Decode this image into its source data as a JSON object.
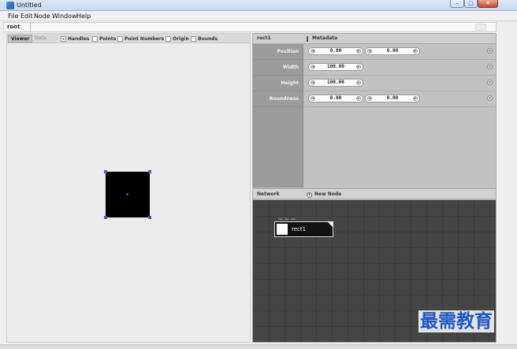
{
  "window": {
    "title": "Untitled"
  },
  "menu": {
    "items": [
      "File",
      "Edit",
      "Node",
      "Window",
      "Help"
    ]
  },
  "address": {
    "crumb": "root"
  },
  "viewer": {
    "tabs": [
      "Viewer",
      "Data"
    ],
    "options": [
      {
        "label": "Handles",
        "checked": true
      },
      {
        "label": "Points",
        "checked": false
      },
      {
        "label": "Point Numbers",
        "checked": false
      },
      {
        "label": "Origin",
        "checked": false
      },
      {
        "label": "Bounds",
        "checked": false
      }
    ]
  },
  "properties": {
    "node_name": "rect1",
    "metadata_label": "Metadata",
    "rows": [
      {
        "label": "Position",
        "values": [
          "0.00",
          "0.00"
        ]
      },
      {
        "label": "Width",
        "values": [
          "100.00"
        ]
      },
      {
        "label": "Height",
        "values": [
          "100.00"
        ]
      },
      {
        "label": "Roundness",
        "values": [
          "0.00",
          "0.00"
        ]
      }
    ]
  },
  "network": {
    "label": "Network",
    "new_node_label": "New Node",
    "nodes": [
      {
        "label": "rect1"
      }
    ]
  },
  "watermark": "最需教育"
}
